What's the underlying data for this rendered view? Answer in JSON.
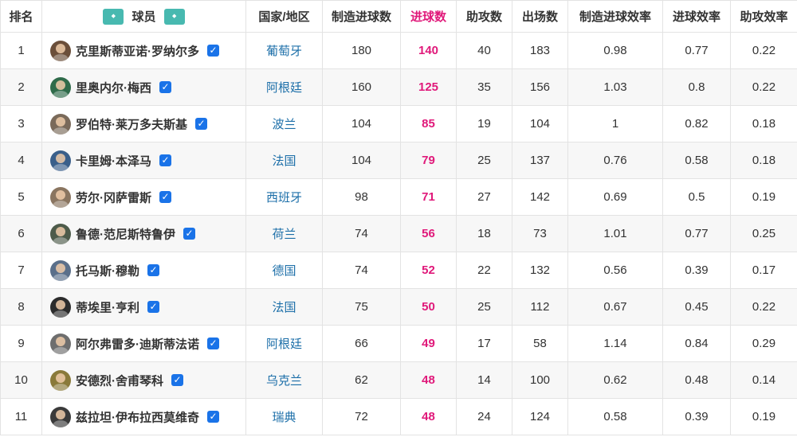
{
  "headers": {
    "rank": "排名",
    "player": "球员",
    "country": "国家/地区",
    "contributions": "制造进球数",
    "goals": "进球数",
    "assists": "助攻数",
    "appearances": "出场数",
    "contrib_rate": "制造进球效率",
    "goal_rate": "进球效率",
    "assist_rate": "助攻效率"
  },
  "header_logo_icon": "team-logo-icon",
  "colors": {
    "goals": "#e0197a",
    "country": "#1b6ea8",
    "checkbox": "#1a73e8",
    "logo": "#48b9b0"
  },
  "rows": [
    {
      "rank": "1",
      "name": "克里斯蒂亚诺·罗纳尔多",
      "country": "葡萄牙",
      "contributions": "180",
      "goals": "140",
      "assists": "40",
      "appearances": "183",
      "contrib_rate": "0.98",
      "goal_rate": "0.77",
      "assist_rate": "0.22",
      "avatar": "#6b4f3a"
    },
    {
      "rank": "2",
      "name": "里奥内尔·梅西",
      "country": "阿根廷",
      "contributions": "160",
      "goals": "125",
      "assists": "35",
      "appearances": "156",
      "contrib_rate": "1.03",
      "goal_rate": "0.8",
      "assist_rate": "0.22",
      "avatar": "#2f6b4a"
    },
    {
      "rank": "3",
      "name": "罗伯特·莱万多夫斯基",
      "country": "波兰",
      "contributions": "104",
      "goals": "85",
      "assists": "19",
      "appearances": "104",
      "contrib_rate": "1",
      "goal_rate": "0.82",
      "assist_rate": "0.18",
      "avatar": "#7a6a5a"
    },
    {
      "rank": "4",
      "name": "卡里姆·本泽马",
      "country": "法国",
      "contributions": "104",
      "goals": "79",
      "assists": "25",
      "appearances": "137",
      "contrib_rate": "0.76",
      "goal_rate": "0.58",
      "assist_rate": "0.18",
      "avatar": "#3a5f8a"
    },
    {
      "rank": "5",
      "name": "劳尔·冈萨雷斯",
      "country": "西班牙",
      "contributions": "98",
      "goals": "71",
      "assists": "27",
      "appearances": "142",
      "contrib_rate": "0.69",
      "goal_rate": "0.5",
      "assist_rate": "0.19",
      "avatar": "#8a7560"
    },
    {
      "rank": "6",
      "name": "鲁德·范尼斯特鲁伊",
      "country": "荷兰",
      "contributions": "74",
      "goals": "56",
      "assists": "18",
      "appearances": "73",
      "contrib_rate": "1.01",
      "goal_rate": "0.77",
      "assist_rate": "0.25",
      "avatar": "#4d5b4a"
    },
    {
      "rank": "7",
      "name": "托马斯·穆勒",
      "country": "德国",
      "contributions": "74",
      "goals": "52",
      "assists": "22",
      "appearances": "132",
      "contrib_rate": "0.56",
      "goal_rate": "0.39",
      "assist_rate": "0.17",
      "avatar": "#5a6f8a"
    },
    {
      "rank": "8",
      "name": "蒂埃里·亨利",
      "country": "法国",
      "contributions": "75",
      "goals": "50",
      "assists": "25",
      "appearances": "112",
      "contrib_rate": "0.67",
      "goal_rate": "0.45",
      "assist_rate": "0.22",
      "avatar": "#2c2c2c"
    },
    {
      "rank": "9",
      "name": "阿尔弗雷多·迪斯蒂法诺",
      "country": "阿根廷",
      "contributions": "66",
      "goals": "49",
      "assists": "17",
      "appearances": "58",
      "contrib_rate": "1.14",
      "goal_rate": "0.84",
      "assist_rate": "0.29",
      "avatar": "#6e6e6e"
    },
    {
      "rank": "10",
      "name": "安德烈·舍甫琴科",
      "country": "乌克兰",
      "contributions": "62",
      "goals": "48",
      "assists": "14",
      "appearances": "100",
      "contrib_rate": "0.62",
      "goal_rate": "0.48",
      "assist_rate": "0.14",
      "avatar": "#8a7a3a"
    },
    {
      "rank": "11",
      "name": "兹拉坦·伊布拉西莫维奇",
      "country": "瑞典",
      "contributions": "72",
      "goals": "48",
      "assists": "24",
      "appearances": "124",
      "contrib_rate": "0.58",
      "goal_rate": "0.39",
      "assist_rate": "0.19",
      "avatar": "#3a3a3a"
    }
  ]
}
